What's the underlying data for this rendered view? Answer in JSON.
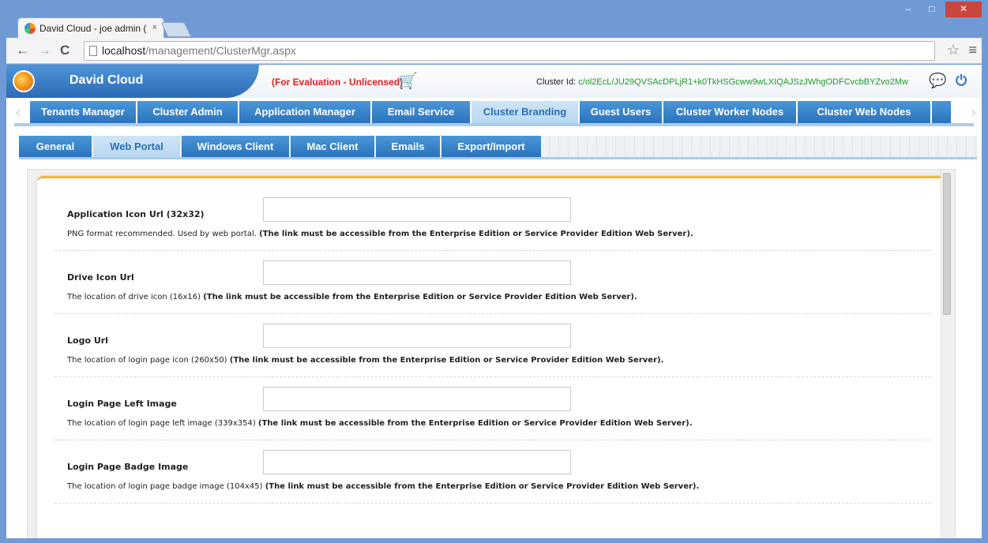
{
  "browser": {
    "tab_title": "David Cloud - joe admin (",
    "tab_close": "×",
    "url_host": "localhost",
    "url_path": "/management/ClusterMgr.aspx",
    "window_controls": {
      "minimize": "–",
      "maximize": "□",
      "close": "✕"
    },
    "nav": {
      "back": "←",
      "forward": "→",
      "reload": "C",
      "star": "☆",
      "menu": "≡"
    }
  },
  "header": {
    "brand": "David Cloud",
    "evaluation": "(For Evaluation - Unlicensed)",
    "cart_icon": "🛒",
    "cluster_label": "Cluster Id: ",
    "cluster_id": "c/ol2EcL/JU29QVSAcDPLjR1+k0TkHSGcww9wLXIQAJSzJWhgODFCvcbBYZvo2Mw",
    "chat_icon": "💬",
    "power_icon": "⏻"
  },
  "main_nav": {
    "left_arrow": "‹",
    "right_arrow": "›",
    "items": [
      {
        "label": "Tenants Manager"
      },
      {
        "label": "Cluster Admin"
      },
      {
        "label": "Application Manager"
      },
      {
        "label": "Email Service"
      },
      {
        "label": "Cluster Branding",
        "active": true
      },
      {
        "label": "Guest Users"
      },
      {
        "label": "Cluster Worker Nodes"
      },
      {
        "label": "Cluster Web Nodes"
      }
    ]
  },
  "sub_nav": {
    "items": [
      {
        "label": "General"
      },
      {
        "label": "Web Portal",
        "active": true
      },
      {
        "label": "Windows Client"
      },
      {
        "label": "Mac Client"
      },
      {
        "label": "Emails"
      },
      {
        "label": "Export/Import"
      }
    ]
  },
  "fields": [
    {
      "label": "Application Icon Url (32x32)",
      "value": "",
      "help": "PNG format recommended. Used by web portal. ",
      "note": "(The link must be accessible from the Enterprise Edition or Service Provider Edition Web Server)."
    },
    {
      "label": "Drive Icon Url",
      "value": "",
      "help": "The location of drive icon (16x16) ",
      "note": "(The link must be accessible from the Enterprise Edition or Service Provider Edition Web Server)."
    },
    {
      "label": "Logo Url",
      "value": "",
      "help": "The location of login page icon (260x50) ",
      "note": "(The link must be accessible from the Enterprise Edition or Service Provider Edition Web Server)."
    },
    {
      "label": "Login Page Left Image",
      "value": "",
      "help": "The location of login page left image (339x354) ",
      "note": "(The link must be accessible from the Enterprise Edition or Service Provider Edition Web Server)."
    },
    {
      "label": "Login Page Badge Image",
      "value": "",
      "help": "The location of login page badge image (104x45) ",
      "note": "(The link must be accessible from the Enterprise Edition or Service Provider Edition Web Server)."
    }
  ]
}
